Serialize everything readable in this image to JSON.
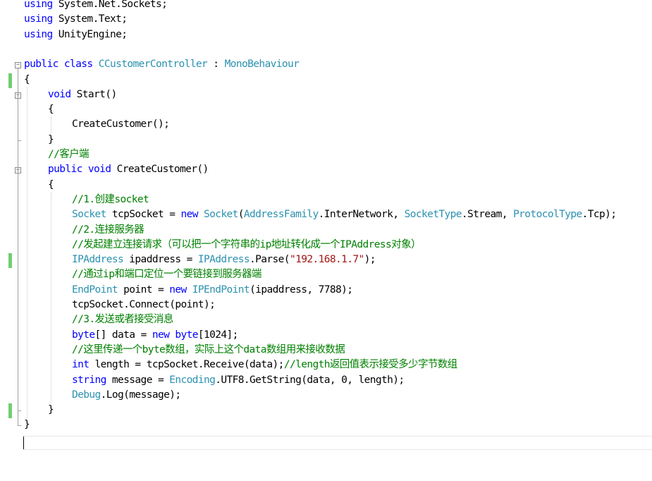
{
  "editor": {
    "lines": [
      {
        "indent": 0,
        "tokens": [
          {
            "t": "kw",
            "v": "using"
          },
          {
            "t": "pl",
            "v": " System.Net.Sockets;"
          }
        ]
      },
      {
        "indent": 0,
        "tokens": [
          {
            "t": "kw",
            "v": "using"
          },
          {
            "t": "pl",
            "v": " System.Text;"
          }
        ]
      },
      {
        "indent": 0,
        "tokens": [
          {
            "t": "kw",
            "v": "using"
          },
          {
            "t": "pl",
            "v": " UnityEngine;"
          }
        ]
      },
      {
        "indent": 0,
        "tokens": []
      },
      {
        "indent": 0,
        "tokens": [
          {
            "t": "kw",
            "v": "public class"
          },
          {
            "t": "pl",
            "v": " "
          },
          {
            "t": "ty",
            "v": "CCustomerController"
          },
          {
            "t": "pl",
            "v": " : "
          },
          {
            "t": "ty",
            "v": "MonoBehaviour"
          }
        ]
      },
      {
        "indent": 0,
        "tokens": [
          {
            "t": "pl",
            "v": "{"
          }
        ]
      },
      {
        "indent": 1,
        "tokens": [
          {
            "t": "kw",
            "v": "void"
          },
          {
            "t": "pl",
            "v": " Start()"
          }
        ]
      },
      {
        "indent": 1,
        "tokens": [
          {
            "t": "pl",
            "v": "{"
          }
        ]
      },
      {
        "indent": 2,
        "tokens": [
          {
            "t": "pl",
            "v": "CreateCustomer();"
          }
        ]
      },
      {
        "indent": 1,
        "tokens": [
          {
            "t": "pl",
            "v": "}"
          }
        ]
      },
      {
        "indent": 1,
        "tokens": [
          {
            "t": "cm",
            "v": "//客户端"
          }
        ]
      },
      {
        "indent": 1,
        "tokens": [
          {
            "t": "kw",
            "v": "public void"
          },
          {
            "t": "pl",
            "v": " CreateCustomer()"
          }
        ]
      },
      {
        "indent": 1,
        "tokens": [
          {
            "t": "pl",
            "v": "{"
          }
        ]
      },
      {
        "indent": 2,
        "tokens": [
          {
            "t": "cm",
            "v": "//1.创建socket"
          }
        ]
      },
      {
        "indent": 2,
        "tokens": [
          {
            "t": "ty",
            "v": "Socket"
          },
          {
            "t": "pl",
            "v": " tcpSocket = "
          },
          {
            "t": "kw",
            "v": "new"
          },
          {
            "t": "pl",
            "v": " "
          },
          {
            "t": "ty",
            "v": "Socket"
          },
          {
            "t": "pl",
            "v": "("
          },
          {
            "t": "ty",
            "v": "AddressFamily"
          },
          {
            "t": "pl",
            "v": ".InterNetwork, "
          },
          {
            "t": "ty",
            "v": "SocketType"
          },
          {
            "t": "pl",
            "v": ".Stream, "
          },
          {
            "t": "ty",
            "v": "ProtocolType"
          },
          {
            "t": "pl",
            "v": ".Tcp);"
          }
        ]
      },
      {
        "indent": 2,
        "tokens": [
          {
            "t": "cm",
            "v": "//2.连接服务器"
          }
        ]
      },
      {
        "indent": 2,
        "tokens": [
          {
            "t": "cm",
            "v": "//发起建立连接请求（可以把一个字符串的ip地址转化成一个IPAddress对象）"
          }
        ]
      },
      {
        "indent": 2,
        "tokens": [
          {
            "t": "ty",
            "v": "IPAddress"
          },
          {
            "t": "pl",
            "v": " ipaddress = "
          },
          {
            "t": "ty",
            "v": "IPAddress"
          },
          {
            "t": "pl",
            "v": ".Parse("
          },
          {
            "t": "str",
            "v": "\"192.168.1.7\""
          },
          {
            "t": "pl",
            "v": ");"
          }
        ]
      },
      {
        "indent": 2,
        "tokens": [
          {
            "t": "cm",
            "v": "//通过ip和端口定位一个要链接到服务器端"
          }
        ]
      },
      {
        "indent": 2,
        "tokens": [
          {
            "t": "ty",
            "v": "EndPoint"
          },
          {
            "t": "pl",
            "v": " point = "
          },
          {
            "t": "kw",
            "v": "new"
          },
          {
            "t": "pl",
            "v": " "
          },
          {
            "t": "ty",
            "v": "IPEndPoint"
          },
          {
            "t": "pl",
            "v": "(ipaddress, 7788);"
          }
        ]
      },
      {
        "indent": 2,
        "tokens": [
          {
            "t": "pl",
            "v": "tcpSocket.Connect(point);"
          }
        ]
      },
      {
        "indent": 2,
        "tokens": [
          {
            "t": "cm",
            "v": "//3.发送或者接受消息"
          }
        ]
      },
      {
        "indent": 2,
        "tokens": [
          {
            "t": "kw",
            "v": "byte"
          },
          {
            "t": "pl",
            "v": "[] data = "
          },
          {
            "t": "kw",
            "v": "new byte"
          },
          {
            "t": "pl",
            "v": "[1024];"
          }
        ]
      },
      {
        "indent": 2,
        "tokens": [
          {
            "t": "cm",
            "v": "//这里传递一个byte数组，实际上这个data数组用来接收数据"
          }
        ]
      },
      {
        "indent": 2,
        "tokens": [
          {
            "t": "kw",
            "v": "int"
          },
          {
            "t": "pl",
            "v": " length = tcpSocket.Receive(data);"
          },
          {
            "t": "cm",
            "v": "//length返回值表示接受多少字节数组"
          }
        ]
      },
      {
        "indent": 2,
        "tokens": [
          {
            "t": "kw",
            "v": "string"
          },
          {
            "t": "pl",
            "v": " message = "
          },
          {
            "t": "ty",
            "v": "Encoding"
          },
          {
            "t": "pl",
            "v": ".UTF8.GetString(data, 0, length);"
          }
        ]
      },
      {
        "indent": 2,
        "tokens": [
          {
            "t": "ty",
            "v": "Debug"
          },
          {
            "t": "pl",
            "v": ".Log(message);"
          }
        ]
      },
      {
        "indent": 1,
        "tokens": [
          {
            "t": "pl",
            "v": "}"
          }
        ]
      },
      {
        "indent": 0,
        "tokens": [
          {
            "t": "pl",
            "v": "}"
          }
        ]
      },
      {
        "indent": 0,
        "tokens": []
      }
    ],
    "fold_markers": [
      {
        "line": 4,
        "symbol": "−"
      },
      {
        "line": 6,
        "symbol": "−"
      },
      {
        "line": 11,
        "symbol": "−"
      }
    ],
    "changed_lines": [
      5,
      17,
      27
    ],
    "colors": {
      "keyword": "#0000ff",
      "type": "#2b91af",
      "string": "#a31515",
      "comment": "#008000",
      "change_bar": "#6fcf6f"
    }
  }
}
